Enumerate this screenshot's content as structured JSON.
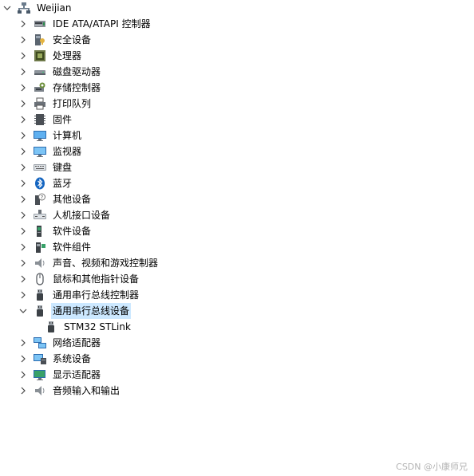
{
  "tree": {
    "root": {
      "label": "Weijian",
      "icon": "computer-network-icon",
      "expanded": true
    },
    "categories": [
      {
        "label": "IDE ATA/ATAPI 控制器",
        "icon": "ide-controller-icon",
        "expanded": false
      },
      {
        "label": "安全设备",
        "icon": "security-device-icon",
        "expanded": false
      },
      {
        "label": "处理器",
        "icon": "processor-icon",
        "expanded": false
      },
      {
        "label": "磁盘驱动器",
        "icon": "disk-drive-icon",
        "expanded": false
      },
      {
        "label": "存储控制器",
        "icon": "storage-controller-icon",
        "expanded": false
      },
      {
        "label": "打印队列",
        "icon": "printer-icon",
        "expanded": false
      },
      {
        "label": "固件",
        "icon": "firmware-icon",
        "expanded": false
      },
      {
        "label": "计算机",
        "icon": "computer-icon",
        "expanded": false
      },
      {
        "label": "监视器",
        "icon": "monitor-icon",
        "expanded": false
      },
      {
        "label": "键盘",
        "icon": "keyboard-icon",
        "expanded": false
      },
      {
        "label": "蓝牙",
        "icon": "bluetooth-icon",
        "expanded": false
      },
      {
        "label": "其他设备",
        "icon": "other-devices-icon",
        "expanded": false
      },
      {
        "label": "人机接口设备",
        "icon": "hid-icon",
        "expanded": false
      },
      {
        "label": "软件设备",
        "icon": "software-device-icon",
        "expanded": false
      },
      {
        "label": "软件组件",
        "icon": "software-component-icon",
        "expanded": false
      },
      {
        "label": "声音、视频和游戏控制器",
        "icon": "sound-icon",
        "expanded": false
      },
      {
        "label": "鼠标和其他指针设备",
        "icon": "mouse-icon",
        "expanded": false
      },
      {
        "label": "通用串行总线控制器",
        "icon": "usb-controller-icon",
        "expanded": false
      },
      {
        "label": "通用串行总线设备",
        "icon": "usb-device-icon",
        "expanded": true,
        "selected": true,
        "children": [
          {
            "label": "STM32 STLink",
            "icon": "usb-device-icon"
          }
        ]
      },
      {
        "label": "网络适配器",
        "icon": "network-adapter-icon",
        "expanded": false
      },
      {
        "label": "系统设备",
        "icon": "system-device-icon",
        "expanded": false
      },
      {
        "label": "显示适配器",
        "icon": "display-adapter-icon",
        "expanded": false
      },
      {
        "label": "音频输入和输出",
        "icon": "audio-io-icon",
        "expanded": false
      }
    ]
  },
  "watermark": "CSDN @小康师兄"
}
